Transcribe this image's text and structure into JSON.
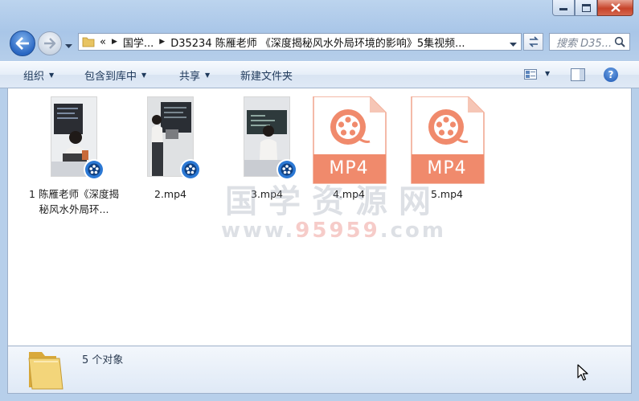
{
  "window": {
    "caption_buttons": [
      "minimize-icon",
      "maximize-icon",
      "close-icon"
    ]
  },
  "nav": {
    "breadcrumb_overflow": "«",
    "breadcrumb": [
      "国学...",
      "D35234 陈雁老师 《深度揭秘风水外局环境的影响》5集视频..."
    ],
    "search_placeholder": "搜索 D35..."
  },
  "toolbar": {
    "organize": "组织",
    "include_in_library": "包含到库中",
    "share": "共享",
    "new_folder": "新建文件夹"
  },
  "files": [
    {
      "name": "1 陈雁老师《深度揭秘风水外局环...",
      "type": "video-thumbnail"
    },
    {
      "name": "2.mp4",
      "type": "video-thumbnail"
    },
    {
      "name": "3.mp4",
      "type": "video-thumbnail"
    },
    {
      "name": "4.mp4",
      "type": "mp4-icon",
      "icon_text": "MP4"
    },
    {
      "name": "5.mp4",
      "type": "mp4-icon",
      "icon_text": "MP4"
    }
  ],
  "watermark": {
    "line1": "国学资源网",
    "line2_prefix": "www.",
    "line2_num": "95959",
    "line2_suffix": ".com"
  },
  "details": {
    "count": "5 个对象"
  },
  "colors": {
    "accent": "#1e395b",
    "mp4_orange": "#f08a6c",
    "close_red": "#c7442b",
    "frame_blue": "#b7cfea"
  }
}
